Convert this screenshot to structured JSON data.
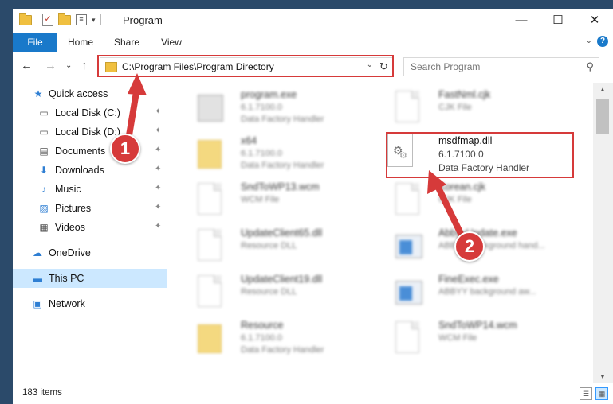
{
  "window": {
    "title": "Program",
    "minimize_glyph": "—",
    "maximize_glyph": "☐",
    "close_glyph": "✕"
  },
  "ribbon": {
    "tabs": [
      "File",
      "Home",
      "Share",
      "View"
    ],
    "expand_glyph": "⌄",
    "help_glyph": "?"
  },
  "navigation": {
    "back_glyph": "←",
    "forward_glyph": "→",
    "recent_glyph": "⌄",
    "up_glyph": "↑"
  },
  "address": {
    "path": "C:\\Program Files\\Program Directory",
    "dropdown_glyph": "⌄",
    "refresh_glyph": "↻"
  },
  "search": {
    "placeholder": "Search Program",
    "icon_glyph": "⚲"
  },
  "sidebar": {
    "items": [
      {
        "label": "Quick access",
        "icon": "star-icon",
        "glyph": "★",
        "color": "#2f7fd3",
        "pinned": false
      },
      {
        "label": "Local Disk (C:)",
        "icon": "drive-icon",
        "glyph": "▭",
        "color": "#555555",
        "pinned": true
      },
      {
        "label": "Local Disk (D:)",
        "icon": "drive-icon",
        "glyph": "▭",
        "color": "#555555",
        "pinned": true
      },
      {
        "label": "Documents",
        "icon": "documents-icon",
        "glyph": "▤",
        "color": "#555555",
        "pinned": true
      },
      {
        "label": "Downloads",
        "icon": "download-icon",
        "glyph": "⬇",
        "color": "#2f7fd3",
        "pinned": true
      },
      {
        "label": "Music",
        "icon": "music-icon",
        "glyph": "♪",
        "color": "#2f7fd3",
        "pinned": true
      },
      {
        "label": "Pictures",
        "icon": "pictures-icon",
        "glyph": "▨",
        "color": "#2f7fd3",
        "pinned": true
      },
      {
        "label": "Videos",
        "icon": "videos-icon",
        "glyph": "▦",
        "color": "#555555",
        "pinned": true
      },
      {
        "label": "OneDrive",
        "icon": "cloud-icon",
        "glyph": "☁",
        "color": "#2f7fd3",
        "pinned": false
      },
      {
        "label": "This PC",
        "icon": "computer-icon",
        "glyph": "▬",
        "color": "#2f7fd3",
        "pinned": false,
        "selected": true
      },
      {
        "label": "Network",
        "icon": "network-icon",
        "glyph": "▣",
        "color": "#2f7fd3",
        "pinned": false
      }
    ],
    "pin_glyph": "📌"
  },
  "files": [
    {
      "name": "program.exe",
      "line1": "6.1.7100.0",
      "line2": "Data Factory Handler",
      "icon": "exe-file-icon"
    },
    {
      "name": "FastNml.cjk",
      "line1": "CJK File",
      "line2": "",
      "icon": "document-icon"
    },
    {
      "name": "x64",
      "line1": "6.1.7100.0",
      "line2": "Data Factory Handler",
      "icon": "folder-icon"
    },
    {
      "name": "msdfmap.dll",
      "line1": "6.1.7100.0",
      "line2": "Data Factory Handler",
      "icon": "dll-gear-icon",
      "highlighted": true
    },
    {
      "name": "SndToWP13.wcm",
      "line1": "WCM File",
      "line2": "",
      "icon": "document-icon"
    },
    {
      "name": "Korean.cjk",
      "line1": "CJK File",
      "line2": "",
      "icon": "document-icon"
    },
    {
      "name": "UpdateClient65.dll",
      "line1": "Resource DLL",
      "line2": "",
      "icon": "dll-icon"
    },
    {
      "name": "AbbyyUpdate.exe",
      "line1": "ABBYY background hand...",
      "line2": "",
      "icon": "app-icon"
    },
    {
      "name": "UpdateClient19.dll",
      "line1": "Resource DLL",
      "line2": "",
      "icon": "dll-icon"
    },
    {
      "name": "FineExec.exe",
      "line1": "ABBYY background aw...",
      "line2": "",
      "icon": "app-icon"
    },
    {
      "name": "Resource",
      "line1": "6.1.7100.0",
      "line2": "Data Factory Handler",
      "icon": "folder-icon"
    },
    {
      "name": "SndToWP14.wcm",
      "line1": "WCM File",
      "line2": "",
      "icon": "document-icon"
    }
  ],
  "status": {
    "item_count": "183 items"
  },
  "annotations": {
    "callout_1": "1",
    "callout_2": "2",
    "highlight_color": "#d63a3a"
  }
}
